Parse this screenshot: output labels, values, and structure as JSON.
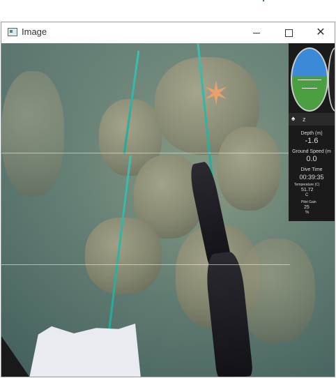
{
  "window": {
    "title": "Image",
    "minimize_glyph": "",
    "maximize_glyph": "",
    "close_glyph": "✕"
  },
  "hud": {
    "attitude_marks": [
      "",
      ""
    ],
    "strip_label": "z",
    "depth_label": "Depth (m)",
    "depth_value": "-1.6",
    "ground_speed_label": "Ground Speed (m",
    "ground_speed_value": "0.0",
    "dive_time_label": "Dive Time",
    "dive_time_value": "00:39:35",
    "temperature_label": "Temperature (C)",
    "temperature_value": "51.72",
    "temperature_unit": "C",
    "pilot_gain_label": "Pilot Gain",
    "pilot_gain_value": "25",
    "pilot_gain_unit": "%"
  }
}
